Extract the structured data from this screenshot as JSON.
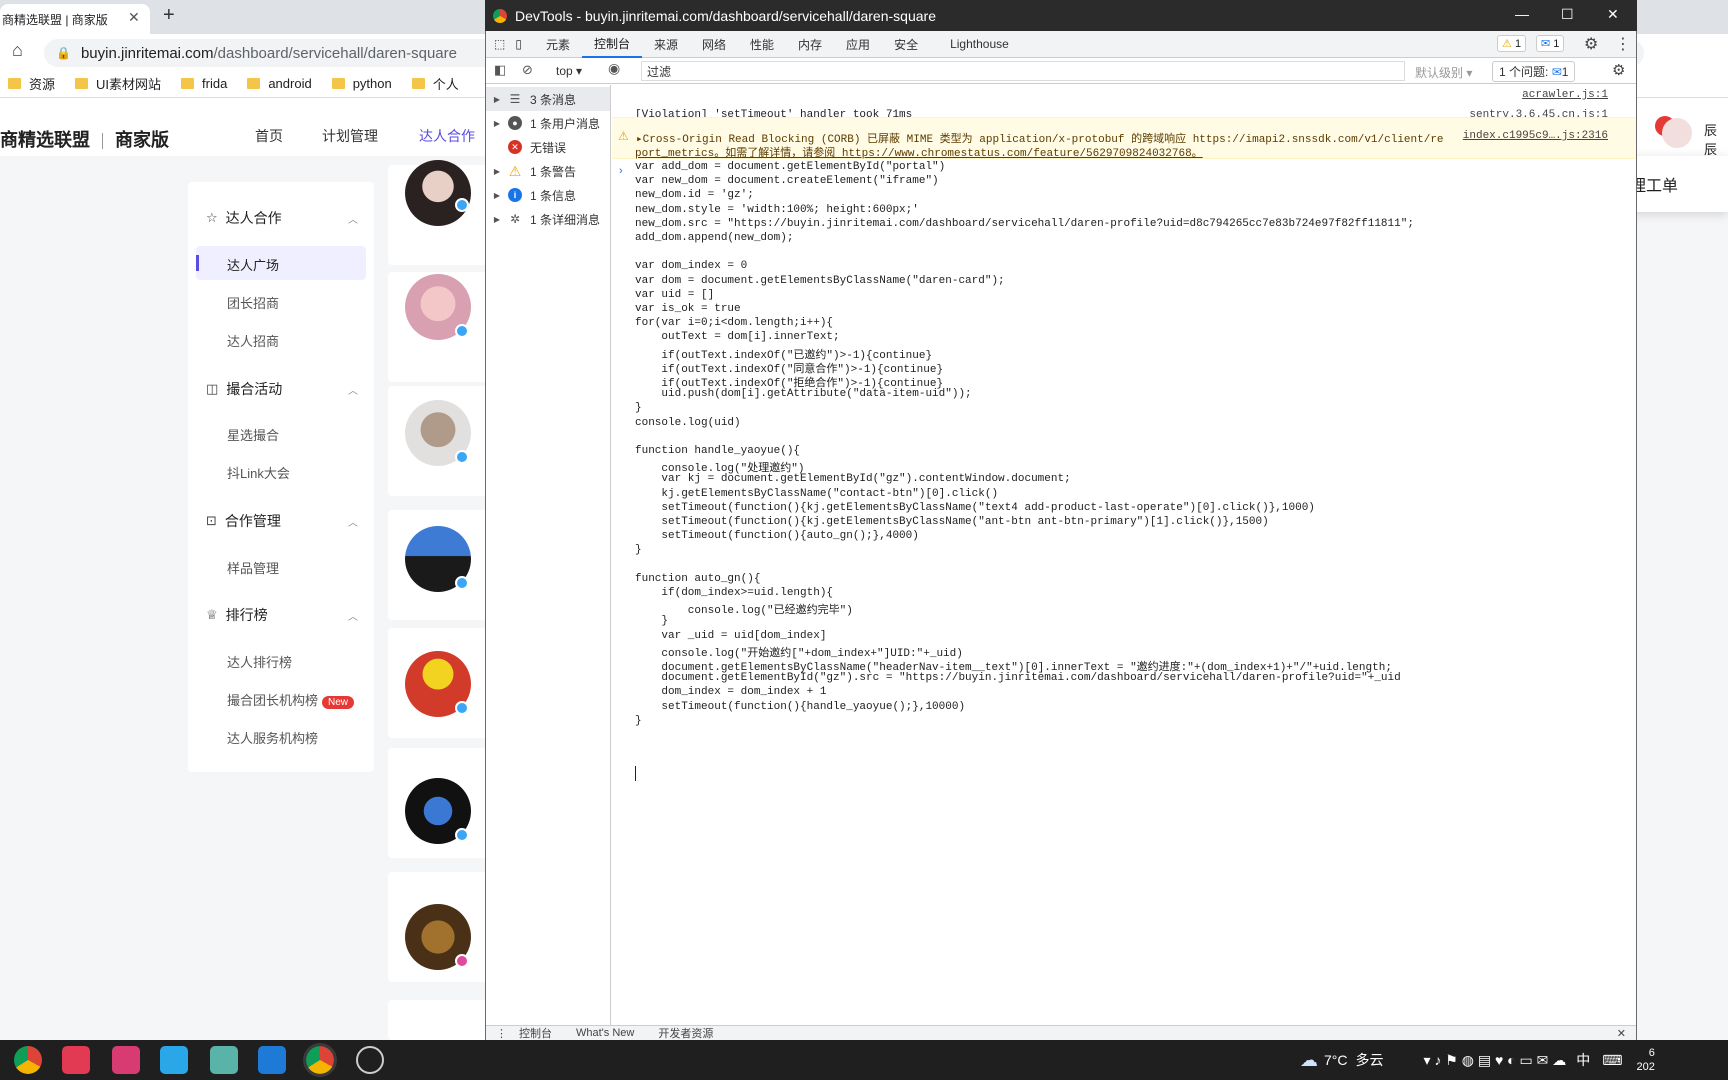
{
  "browser": {
    "tab_title": "商精选联盟 | 商家版",
    "url_host": "buyin.jinritemai.com",
    "url_path": "/dashboard/servicehall/daren-square",
    "bookmarks": [
      "资源",
      "UI素材网站",
      "frida",
      "android",
      "python",
      "个人"
    ]
  },
  "page": {
    "brand": "商精选联盟",
    "brand_sub": "商家版",
    "nav": [
      "首页",
      "计划管理",
      "达人合作"
    ],
    "sidebar": {
      "groups": [
        {
          "label": "达人合作",
          "icon": "star-icon",
          "items": [
            "达人广场",
            "团长招商",
            "达人招商"
          ]
        },
        {
          "label": "撮合活动",
          "icon": "match-icon",
          "items": [
            "星选撮合",
            "抖Link大会"
          ]
        },
        {
          "label": "合作管理",
          "icon": "handshake-icon",
          "items": [
            "样品管理"
          ]
        },
        {
          "label": "排行榜",
          "icon": "trophy-icon",
          "items": [
            "达人排行榜",
            "撮合团长机构榜",
            "达人服务机构榜"
          ]
        }
      ],
      "new_badge": "New"
    },
    "toast": "您当前暂无待处理工单",
    "right_text": "辰辰"
  },
  "devtools": {
    "title": "DevTools - buyin.jinritemai.com/dashboard/servicehall/daren-square",
    "tabs": [
      "元素",
      "控制台",
      "来源",
      "网络",
      "性能",
      "内存",
      "应用",
      "安全",
      "Lighthouse"
    ],
    "warn_count": "1",
    "msg_count": "1",
    "context": "top",
    "filter_placeholder": "过滤",
    "level": "默认级别",
    "issues_label": "1 个问题:",
    "issues_count": "1",
    "sidebar": [
      {
        "label": "3 条消息",
        "icon": "list-icon"
      },
      {
        "label": "1 条用户消息",
        "icon": "user-icon"
      },
      {
        "label": "无错误",
        "icon": "error-icon"
      },
      {
        "label": "1 条警告",
        "icon": "warning-icon"
      },
      {
        "label": "1 条信息",
        "icon": "info-icon"
      },
      {
        "label": "1 条详细消息",
        "icon": "bug-icon"
      }
    ],
    "console": {
      "src1": "acrawler.js:1",
      "violation": "[Violation] 'setTimeout' handler took 71ms",
      "src2": "sentry.3.6.45.cn.js:1",
      "corb1": "Cross-Origin Read Blocking (CORB) 已屏蔽 MIME 类型为 application/x-protobuf 的跨域响应 https://imapi2.snssdk.com/v1/client/re",
      "corb2": "port_metrics。如需了解详情，请参阅 https://www.chromestatus.com/feature/5629709824032768。",
      "src3": "index.c1995c9….js:2316",
      "code": [
        "var add_dom = document.getElementById(\"portal\")",
        "var new_dom = document.createElement(\"iframe\")",
        "new_dom.id = 'gz';",
        "new_dom.style = 'width:100%; height:600px;'",
        "new_dom.src = \"https://buyin.jinritemai.com/dashboard/servicehall/daren-profile?uid=d8c794265cc7e83b724e97f82ff11811\";",
        "add_dom.append(new_dom);",
        "",
        "var dom_index = 0",
        "var dom = document.getElementsByClassName(\"daren-card\");",
        "var uid = []",
        "var is_ok = true",
        "for(var i=0;i<dom.length;i++){",
        "    outText = dom[i].innerText;",
        "    if(outText.indexOf(\"已邀约\")>-1){continue}",
        "    if(outText.indexOf(\"同意合作\")>-1){continue}",
        "    if(outText.indexOf(\"拒绝合作\")>-1){continue}",
        "    uid.push(dom[i].getAttribute(\"data-item-uid\"));",
        "}",
        "console.log(uid)",
        "",
        "function handle_yaoyue(){",
        "    console.log(\"处理邀约\")",
        "    var kj = document.getElementById(\"gz\").contentWindow.document;",
        "    kj.getElementsByClassName(\"contact-btn\")[0].click()",
        "    setTimeout(function(){kj.getElementsByClassName(\"text4 add-product-last-operate\")[0].click()},1000)",
        "    setTimeout(function(){kj.getElementsByClassName(\"ant-btn ant-btn-primary\")[1].click()},1500)",
        "    setTimeout(function(){auto_gn();},4000)",
        "}",
        "",
        "function auto_gn(){",
        "    if(dom_index>=uid.length){",
        "        console.log(\"已经邀约完毕\")",
        "    }",
        "    var _uid = uid[dom_index]",
        "    console.log(\"开始邀约[\"+dom_index+\"]UID:\"+_uid)",
        "    document.getElementsByClassName(\"headerNav-item__text\")[0].innerText = \"邀约进度:\"+(dom_index+1)+\"/\"+uid.length;",
        "    document.getElementById(\"gz\").src = \"https://buyin.jinritemai.com/dashboard/servicehall/daren-profile?uid=\"+_uid",
        "    dom_index = dom_index + 1",
        "    setTimeout(function(){handle_yaoyue();},10000)",
        "}"
      ]
    },
    "drawer_tabs": [
      "控制台",
      "What's New",
      "开发者资源"
    ]
  },
  "taskbar": {
    "weather": "7°C",
    "weather_desc": "多云",
    "ime": "中",
    "clock_partial": "6",
    "date_partial": "202"
  },
  "colors": {
    "accent": "#1a73e8",
    "brand": "#5a4de0",
    "warn_bg": "#fffbe5"
  }
}
